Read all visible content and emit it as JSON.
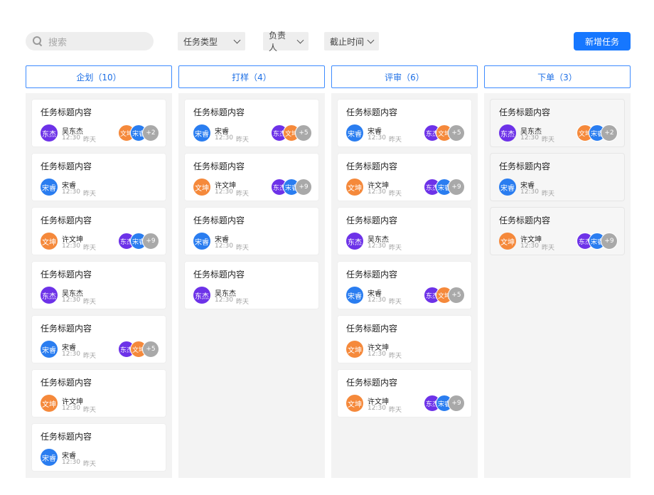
{
  "toolbar": {
    "search_placeholder": "搜索",
    "filters": [
      "任务类型",
      "负责人",
      "截止时间"
    ],
    "new_task_label": "新增任务"
  },
  "colors": {
    "primary": "#1677ff",
    "dongjie": "#6d32e8",
    "songrui": "#2a7df0",
    "wenkun": "#f5893b",
    "more": "#a9a9a9"
  },
  "columns": [
    {
      "title": "企划（10）",
      "cards": [
        {
          "title": "任务标题内容",
          "avatar": "东杰",
          "avatar_color": "dongjie",
          "owner": "吴东杰",
          "time": "12:30",
          "date": "昨天",
          "members": [
            "文坤",
            "宋睿"
          ],
          "more": "+2"
        },
        {
          "title": "任务标题内容",
          "avatar": "宋睿",
          "avatar_color": "songrui",
          "owner": "宋睿",
          "time": "12:30",
          "date": "昨天",
          "members": [],
          "more": ""
        },
        {
          "title": "任务标题内容",
          "avatar": "文坤",
          "avatar_color": "wenkun",
          "owner": "许文坤",
          "time": "12:30",
          "date": "昨天",
          "members": [
            "东杰",
            "宋睿"
          ],
          "more": "+9"
        },
        {
          "title": "任务标题内容",
          "avatar": "东杰",
          "avatar_color": "dongjie",
          "owner": "吴东杰",
          "time": "12:30",
          "date": "昨天",
          "members": [],
          "more": ""
        },
        {
          "title": "任务标题内容",
          "avatar": "宋睿",
          "avatar_color": "songrui",
          "owner": "宋睿",
          "time": "12:30",
          "date": "昨天",
          "members": [
            "东杰",
            "文坤"
          ],
          "more": "+5"
        },
        {
          "title": "任务标题内容",
          "avatar": "文坤",
          "avatar_color": "wenkun",
          "owner": "许文坤",
          "time": "12:30",
          "date": "昨天",
          "members": [],
          "more": ""
        },
        {
          "title": "任务标题内容",
          "avatar": "宋睿",
          "avatar_color": "songrui",
          "owner": "宋睿",
          "time": "12:30",
          "date": "昨天",
          "members": [],
          "more": ""
        }
      ]
    },
    {
      "title": "打样（4）",
      "cards": [
        {
          "title": "任务标题内容",
          "avatar": "宋睿",
          "avatar_color": "songrui",
          "owner": "宋睿",
          "time": "12:30",
          "date": "昨天",
          "members": [
            "东杰",
            "文坤"
          ],
          "more": "+5"
        },
        {
          "title": "任务标题内容",
          "avatar": "文坤",
          "avatar_color": "wenkun",
          "owner": "许文坤",
          "time": "12:30",
          "date": "昨天",
          "members": [
            "东杰",
            "宋睿"
          ],
          "more": "+9"
        },
        {
          "title": "任务标题内容",
          "avatar": "宋睿",
          "avatar_color": "songrui",
          "owner": "宋睿",
          "time": "12:30",
          "date": "昨天",
          "members": [],
          "more": ""
        },
        {
          "title": "任务标题内容",
          "avatar": "东杰",
          "avatar_color": "dongjie",
          "owner": "吴东杰",
          "time": "12:30",
          "date": "昨天",
          "members": [],
          "more": ""
        }
      ]
    },
    {
      "title": "评审（6）",
      "cards": [
        {
          "title": "任务标题内容",
          "avatar": "宋睿",
          "avatar_color": "songrui",
          "owner": "宋睿",
          "time": "12:30",
          "date": "昨天",
          "members": [
            "东杰",
            "文坤"
          ],
          "more": "+5"
        },
        {
          "title": "任务标题内容",
          "avatar": "文坤",
          "avatar_color": "wenkun",
          "owner": "许文坤",
          "time": "12:30",
          "date": "昨天",
          "members": [
            "东杰",
            "宋睿"
          ],
          "more": "+9"
        },
        {
          "title": "任务标题内容",
          "avatar": "东杰",
          "avatar_color": "dongjie",
          "owner": "吴东杰",
          "time": "12:30",
          "date": "昨天",
          "members": [],
          "more": ""
        },
        {
          "title": "任务标题内容",
          "avatar": "宋睿",
          "avatar_color": "songrui",
          "owner": "宋睿",
          "time": "12:30",
          "date": "昨天",
          "members": [
            "东杰",
            "文坤"
          ],
          "more": "+5"
        },
        {
          "title": "任务标题内容",
          "avatar": "文坤",
          "avatar_color": "wenkun",
          "owner": "许文坤",
          "time": "12:30",
          "date": "昨天",
          "members": [],
          "more": ""
        },
        {
          "title": "任务标题内容",
          "avatar": "文坤",
          "avatar_color": "wenkun",
          "owner": "许文坤",
          "time": "12:30",
          "date": "昨天",
          "members": [
            "东杰",
            "宋睿"
          ],
          "more": "+9"
        }
      ]
    },
    {
      "title": "下单（3）",
      "cards": [
        {
          "title": "任务标题内容",
          "avatar": "东杰",
          "avatar_color": "dongjie",
          "owner": "吴东杰",
          "time": "12:30",
          "date": "昨天",
          "members": [
            "文坤",
            "宋睿"
          ],
          "more": "+2"
        },
        {
          "title": "任务标题内容",
          "avatar": "宋睿",
          "avatar_color": "songrui",
          "owner": "宋睿",
          "time": "12:30",
          "date": "昨天",
          "members": [],
          "more": ""
        },
        {
          "title": "任务标题内容",
          "avatar": "文坤",
          "avatar_color": "wenkun",
          "owner": "许文坤",
          "time": "12:30",
          "date": "昨天",
          "members": [
            "东杰",
            "宋睿"
          ],
          "more": "+9"
        }
      ]
    }
  ]
}
